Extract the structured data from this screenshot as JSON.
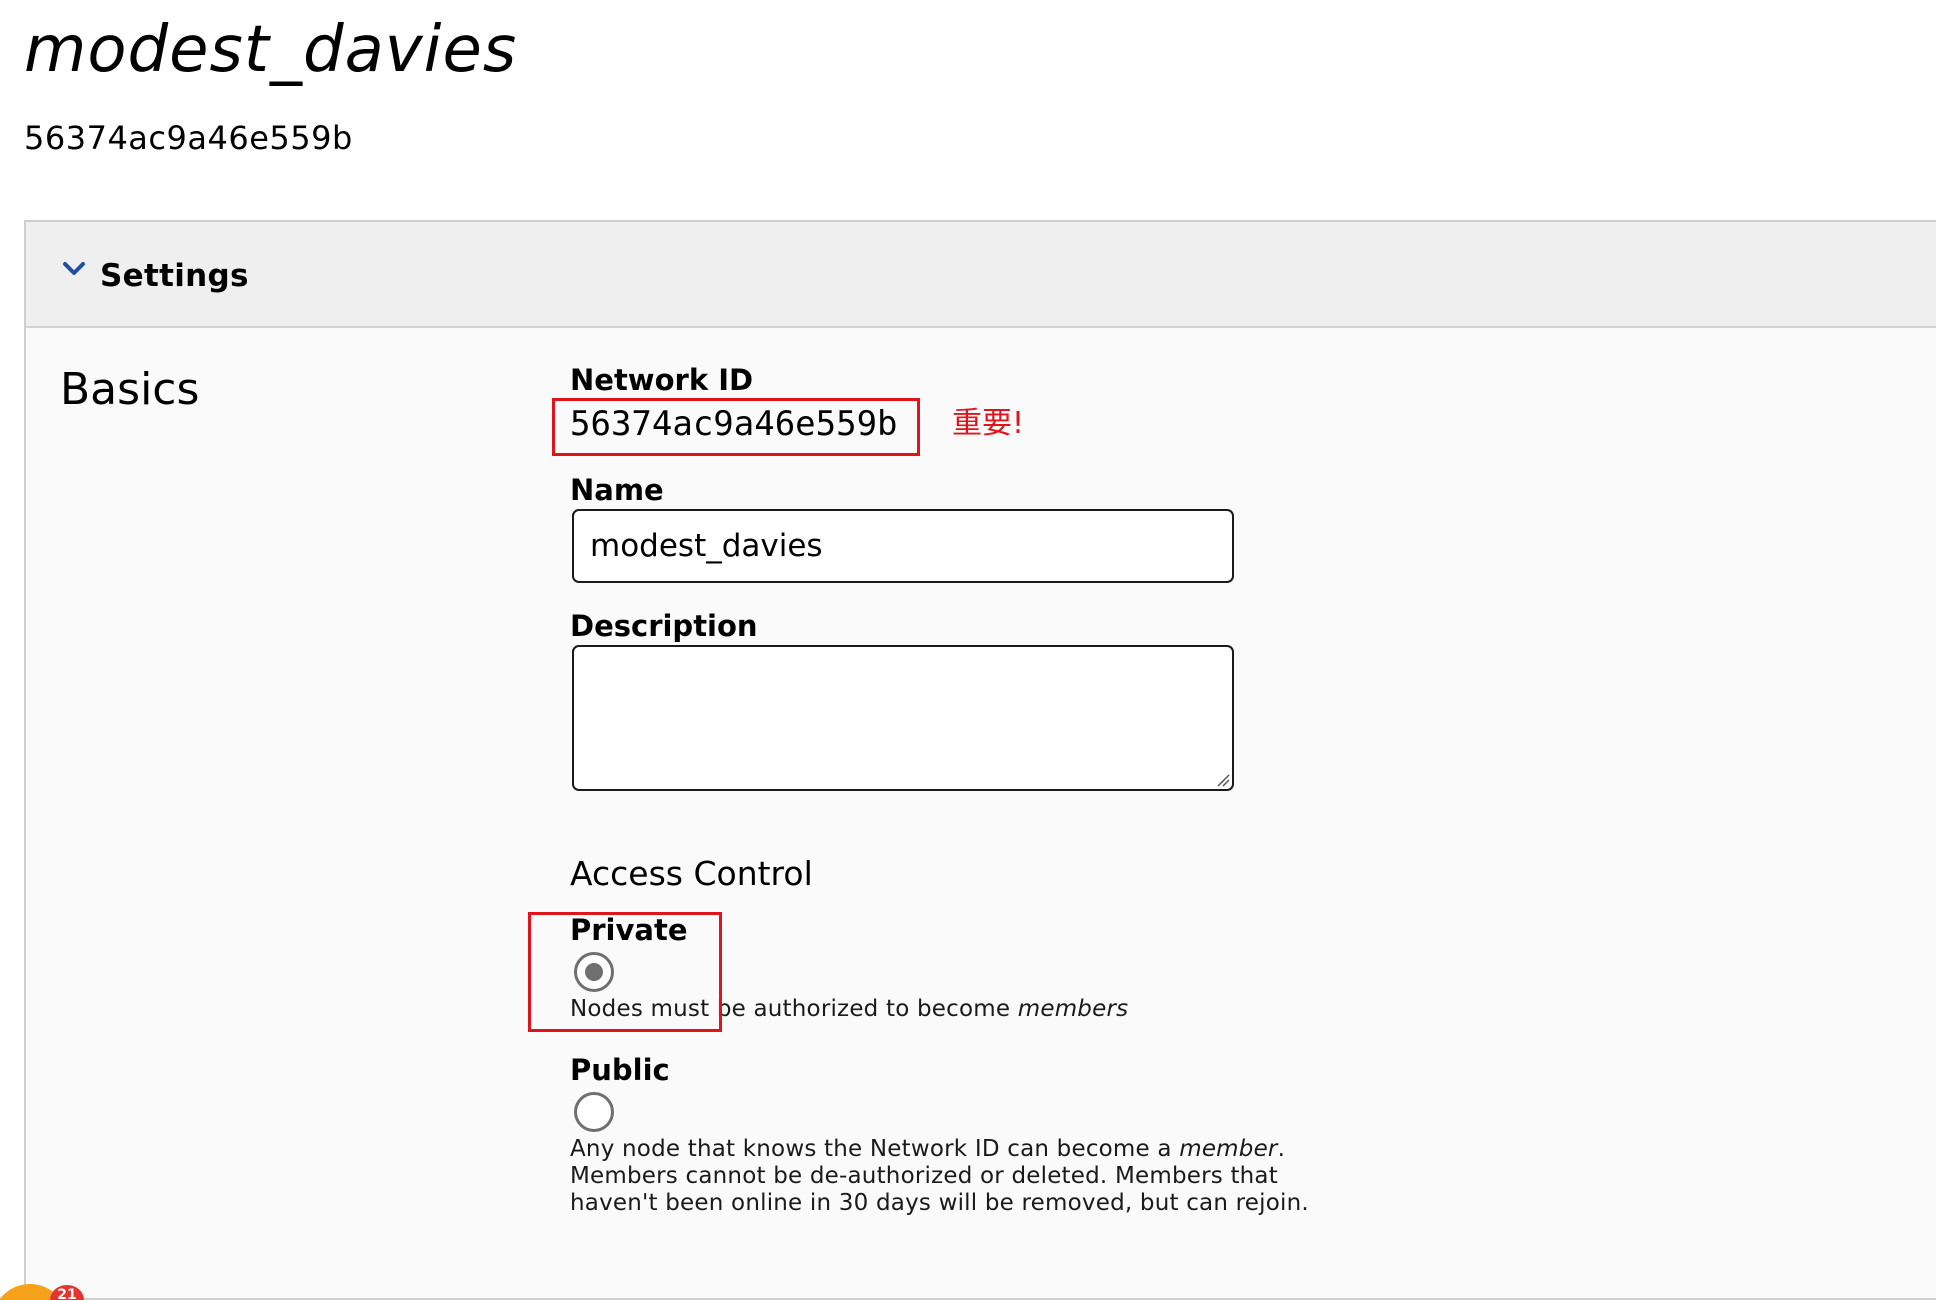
{
  "page": {
    "title": "modest_davies",
    "subtitle": "56374ac9a46e559b"
  },
  "settings_panel": {
    "header_label": "Settings",
    "section_title": "Basics",
    "network_id": {
      "label": "Network ID",
      "value": "56374ac9a46e559b"
    },
    "annotation": {
      "text": "重要!",
      "color": "#e0151c"
    },
    "name": {
      "label": "Name",
      "value": "modest_davies"
    },
    "description": {
      "label": "Description",
      "value": ""
    },
    "access_control": {
      "title": "Access Control",
      "selected": "private",
      "options": [
        {
          "id": "private",
          "label": "Private",
          "description_prefix": "Nodes must be authorized to become ",
          "description_emphasis": "members",
          "description_suffix": ""
        },
        {
          "id": "public",
          "label": "Public",
          "description_line1_prefix": "Any node that knows the Network ID can become a ",
          "description_line1_emphasis": "member",
          "description_line1_suffix": ".",
          "description_line2": "Members cannot be de-authorized or deleted. Members that",
          "description_line3": "haven't been online in 30 days will be removed, but can rejoin."
        }
      ]
    }
  },
  "icons": {
    "header_toggle": "chevron-down-icon",
    "resize": "resize-grip-icon"
  },
  "colors": {
    "chevron": "#1f4fa3",
    "annotation_red": "#e0151c",
    "radio_gray": "#6f6f6f"
  },
  "corner_badge": {
    "count": "21"
  }
}
